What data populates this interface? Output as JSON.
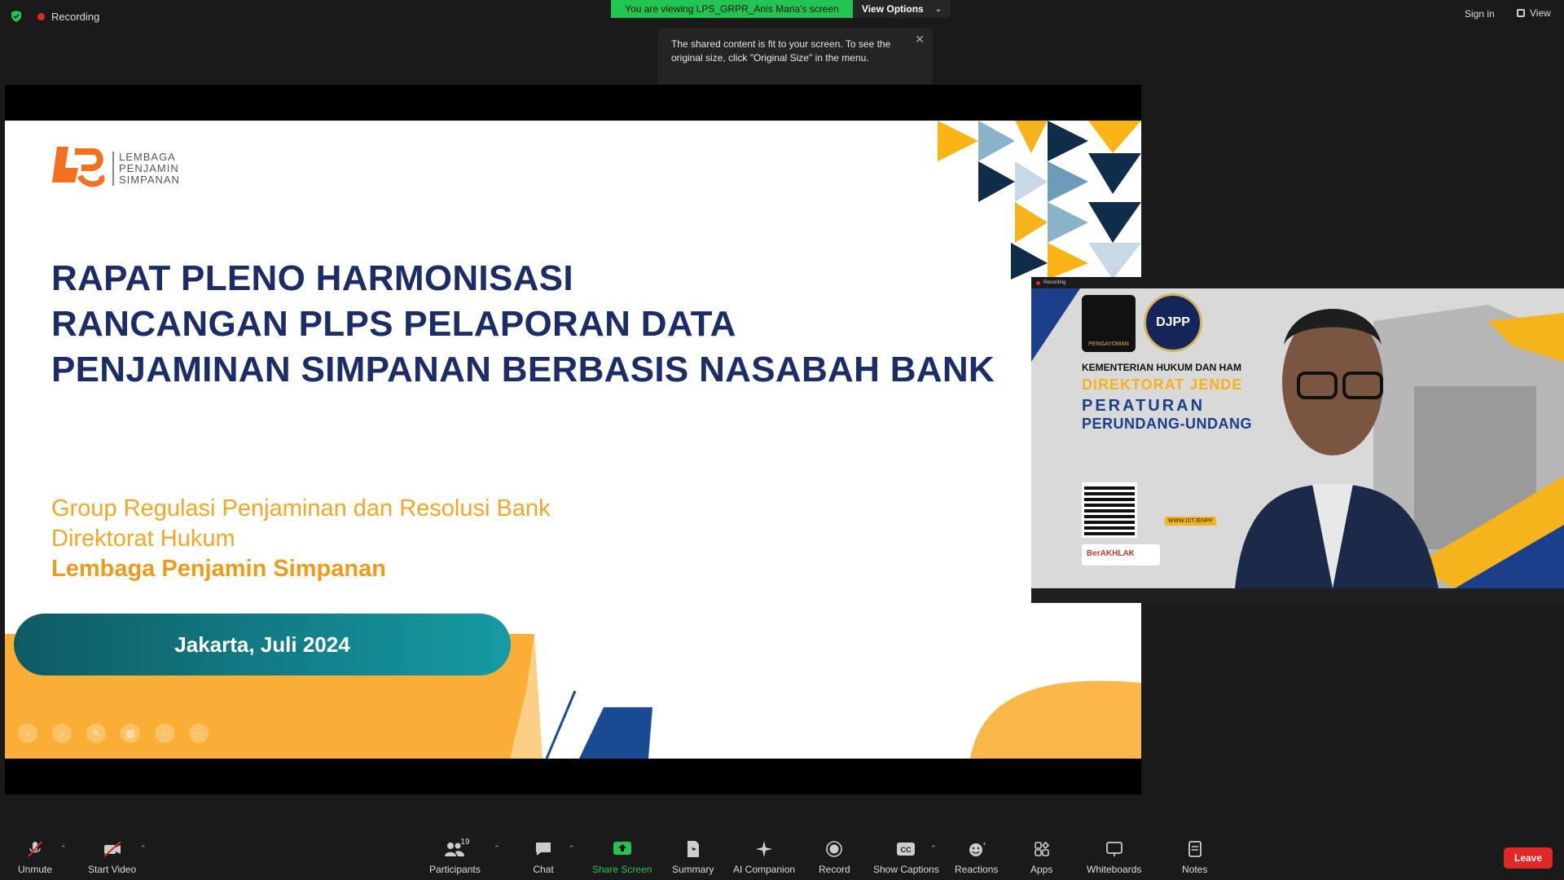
{
  "topbar": {
    "recording_label": "Recording",
    "viewing_banner": "You are viewing LPS_GRPR_Anis Maria's screen",
    "view_options_label": "View Options",
    "tooltip_text": "The shared content is fit to your screen. To see the original size, click \"Original Size\" in the menu.",
    "sign_in_label": "Sign in",
    "view_label": "View"
  },
  "slide": {
    "logo_text": [
      "LEMBAGA",
      "PENJAMIN",
      "SIMPANAN"
    ],
    "logo_mark": "LPS",
    "title_lines": [
      "RAPAT PLENO HARMONISASI",
      "RANCANGAN PLPS PELAPORAN DATA",
      "PENJAMINAN SIMPANAN BERBASIS NASABAH BANK"
    ],
    "subtitle_1": "Group Regulasi Penjaminan dan Resolusi Bank",
    "subtitle_2": "Direktorat Hukum",
    "subtitle_3": "Lembaga Penjamin Simpanan",
    "date": "Jakarta, Juli 2024"
  },
  "video": {
    "top_label": "Recording",
    "badge_1": "PENGAYOMAN",
    "badge_2": "DJPP",
    "line_1": "KEMENTERIAN HUKUM DAN HAM",
    "line_2": "DIREKTORAT JENDE",
    "line_3": "PERATURAN",
    "line_4": "PERUNDANG-UNDANG",
    "akhlak": "BerAKHLAK",
    "www": "WWW.DITJENPP"
  },
  "toolbar": {
    "unmute": "Unmute",
    "start_video": "Start Video",
    "participants": "Participants",
    "participants_count": "19",
    "chat": "Chat",
    "share_screen": "Share Screen",
    "summary": "Summary",
    "ai_companion": "AI Companion",
    "record": "Record",
    "show_captions": "Show Captions",
    "reactions": "Reactions",
    "apps": "Apps",
    "whiteboards": "Whiteboards",
    "notes": "Notes",
    "leave": "Leave"
  },
  "colors": {
    "banner_green": "#23c552",
    "title_navy": "#1b2c66",
    "accent_orange": "#f5a623",
    "leave_red": "#e02828"
  }
}
